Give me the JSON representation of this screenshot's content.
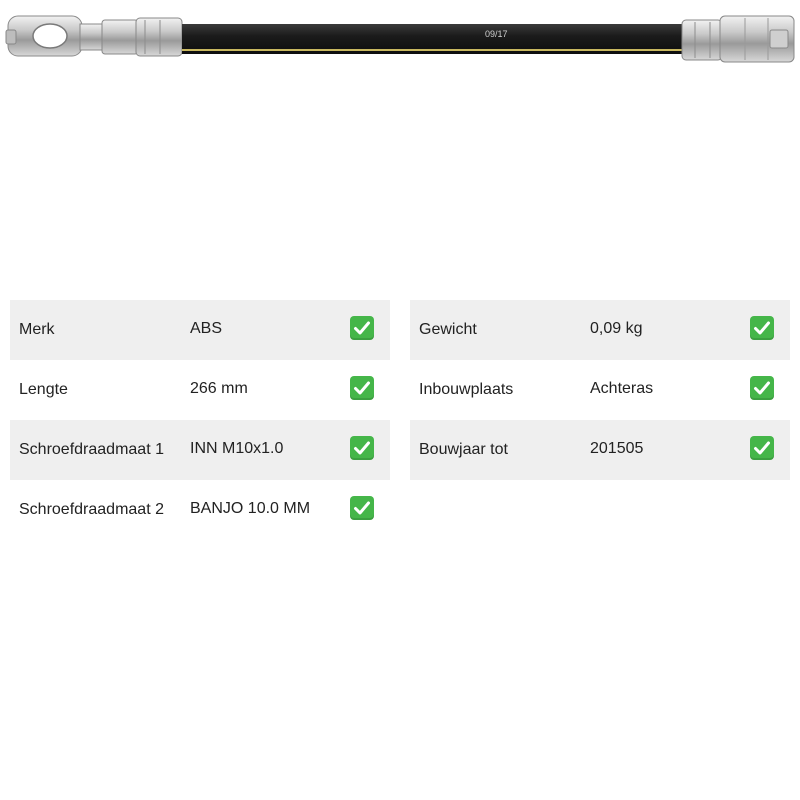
{
  "product": {
    "hose_marking": "09/17"
  },
  "specs_left": [
    {
      "label": "Merk",
      "value": "ABS",
      "icon": "check-icon"
    },
    {
      "label": "Lengte",
      "value": "266 mm",
      "icon": "check-icon"
    },
    {
      "label": "Schroefdraadmaat 1",
      "value": "INN M10x1.0",
      "icon": "check-icon"
    },
    {
      "label": "Schroefdraadmaat 2",
      "value": "BANJO 10.0 MM",
      "icon": "check-icon"
    }
  ],
  "specs_right": [
    {
      "label": "Gewicht",
      "value": "0,09 kg",
      "icon": "check-icon"
    },
    {
      "label": "Inbouwplaats",
      "value": "Achteras",
      "icon": "check-icon"
    },
    {
      "label": "Bouwjaar tot",
      "value": "201505",
      "icon": "check-icon"
    }
  ],
  "colors": {
    "row_shade": "#efefef",
    "check_bg": "#45b649",
    "hose": "#1e1e1e",
    "hose_stripe": "#c9b860"
  }
}
